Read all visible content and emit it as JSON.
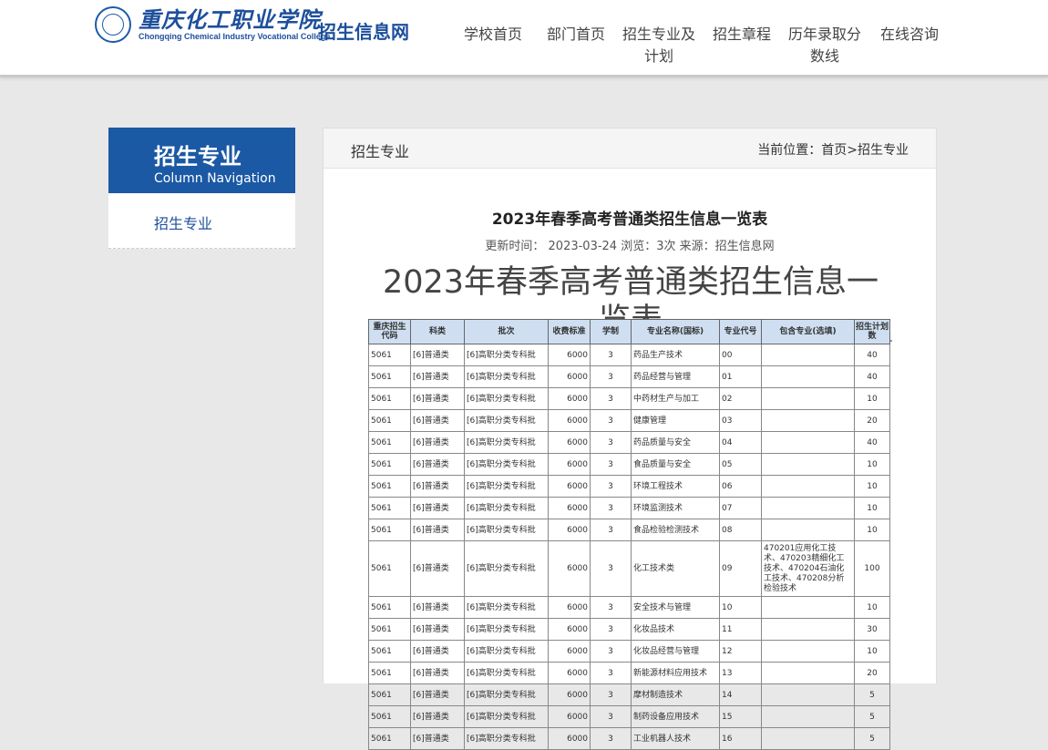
{
  "header": {
    "logo_cn": "重庆化工职业学院",
    "logo_en": "Chongqing Chemical Industry Vocational College",
    "site_name": "招生信息网",
    "nav": [
      {
        "label": "学校首页"
      },
      {
        "label": "部门首页"
      },
      {
        "label": "招生专业及计划"
      },
      {
        "label": "招生章程"
      },
      {
        "label": "历年录取分数线"
      },
      {
        "label": "在线咨询"
      }
    ]
  },
  "sidebar": {
    "title": "招生专业",
    "subtitle": "Column Navigation",
    "items": [
      {
        "label": "招生专业"
      }
    ]
  },
  "main": {
    "section_title": "招生专业",
    "breadcrumb": "当前位置：首页>招生专业",
    "article_title": "2023年春季高考普通类招生信息一览表",
    "meta": "更新时间： 2023-03-24 浏览：3次 来源：招生信息网",
    "big_title": "2023年春季高考普通类招生信息一览表",
    "table": {
      "headers": [
        "重庆招生代码",
        "科类",
        "批次",
        "收费标准",
        "学制",
        "专业名称(国标)",
        "专业代号",
        "包含专业(选填)",
        "招生计划数"
      ],
      "rows": [
        [
          "5061",
          "[6]普通类",
          "[6]高职分类专科批",
          "6000",
          "3",
          "药品生产技术",
          "00",
          "",
          "40"
        ],
        [
          "5061",
          "[6]普通类",
          "[6]高职分类专科批",
          "6000",
          "3",
          "药品经营与管理",
          "01",
          "",
          "40"
        ],
        [
          "5061",
          "[6]普通类",
          "[6]高职分类专科批",
          "6000",
          "3",
          "中药材生产与加工",
          "02",
          "",
          "10"
        ],
        [
          "5061",
          "[6]普通类",
          "[6]高职分类专科批",
          "6000",
          "3",
          "健康管理",
          "03",
          "",
          "20"
        ],
        [
          "5061",
          "[6]普通类",
          "[6]高职分类专科批",
          "6000",
          "3",
          "药品质量与安全",
          "04",
          "",
          "40"
        ],
        [
          "5061",
          "[6]普通类",
          "[6]高职分类专科批",
          "6000",
          "3",
          "食品质量与安全",
          "05",
          "",
          "10"
        ],
        [
          "5061",
          "[6]普通类",
          "[6]高职分类专科批",
          "6000",
          "3",
          "环境工程技术",
          "06",
          "",
          "10"
        ],
        [
          "5061",
          "[6]普通类",
          "[6]高职分类专科批",
          "6000",
          "3",
          "环境监测技术",
          "07",
          "",
          "10"
        ],
        [
          "5061",
          "[6]普通类",
          "[6]高职分类专科批",
          "6000",
          "3",
          "食品检验检测技术",
          "08",
          "",
          "10"
        ],
        [
          "5061",
          "[6]普通类",
          "[6]高职分类专科批",
          "6000",
          "3",
          "化工技术类",
          "09",
          "470201应用化工技术、470203精细化工技术、470204石油化工技术、470208分析检验技术",
          "100"
        ],
        [
          "5061",
          "[6]普通类",
          "[6]高职分类专科批",
          "6000",
          "3",
          "安全技术与管理",
          "10",
          "",
          "10"
        ],
        [
          "5061",
          "[6]普通类",
          "[6]高职分类专科批",
          "6000",
          "3",
          "化妆品技术",
          "11",
          "",
          "30"
        ],
        [
          "5061",
          "[6]普通类",
          "[6]高职分类专科批",
          "6000",
          "3",
          "化妆品经营与管理",
          "12",
          "",
          "10"
        ],
        [
          "5061",
          "[6]普通类",
          "[6]高职分类专科批",
          "6000",
          "3",
          "新能源材料应用技术",
          "13",
          "",
          "20"
        ],
        [
          "5061",
          "[6]普通类",
          "[6]高职分类专科批",
          "6000",
          "3",
          "摩材制造技术",
          "14",
          "",
          "5"
        ],
        [
          "5061",
          "[6]普通类",
          "[6]高职分类专科批",
          "6000",
          "3",
          "制药设备应用技术",
          "15",
          "",
          "5"
        ],
        [
          "5061",
          "[6]普通类",
          "[6]高职分类专科批",
          "6000",
          "3",
          "工业机器人技术",
          "16",
          "",
          "5"
        ]
      ]
    }
  }
}
